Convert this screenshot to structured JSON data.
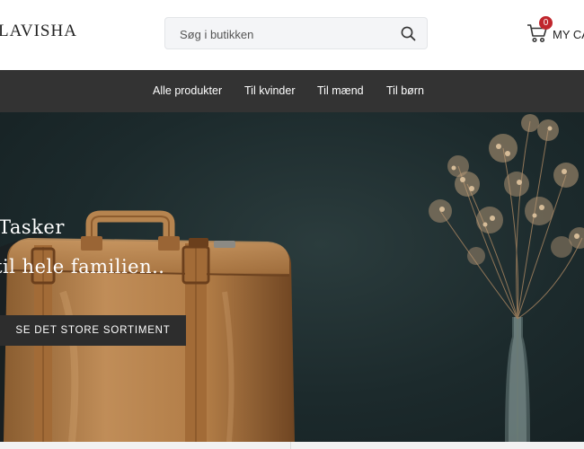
{
  "header": {
    "logo_text": "LAVISHA",
    "search": {
      "placeholder": "Søg i butikken"
    },
    "cart": {
      "count": "0",
      "label": "MY CA"
    }
  },
  "nav": {
    "items": [
      {
        "label": "Alle produkter"
      },
      {
        "label": "Til kvinder"
      },
      {
        "label": "Til mænd"
      },
      {
        "label": "Til børn"
      }
    ]
  },
  "hero": {
    "title": "Tasker",
    "subtitle": "til hele familien..",
    "cta_label": "SE DET STORE SORTIMENT",
    "colors": {
      "background": "#1c2a2c",
      "bag": "#b98550",
      "button": "#2d2d2d"
    }
  },
  "icons": [
    "search-icon",
    "cart-icon"
  ]
}
